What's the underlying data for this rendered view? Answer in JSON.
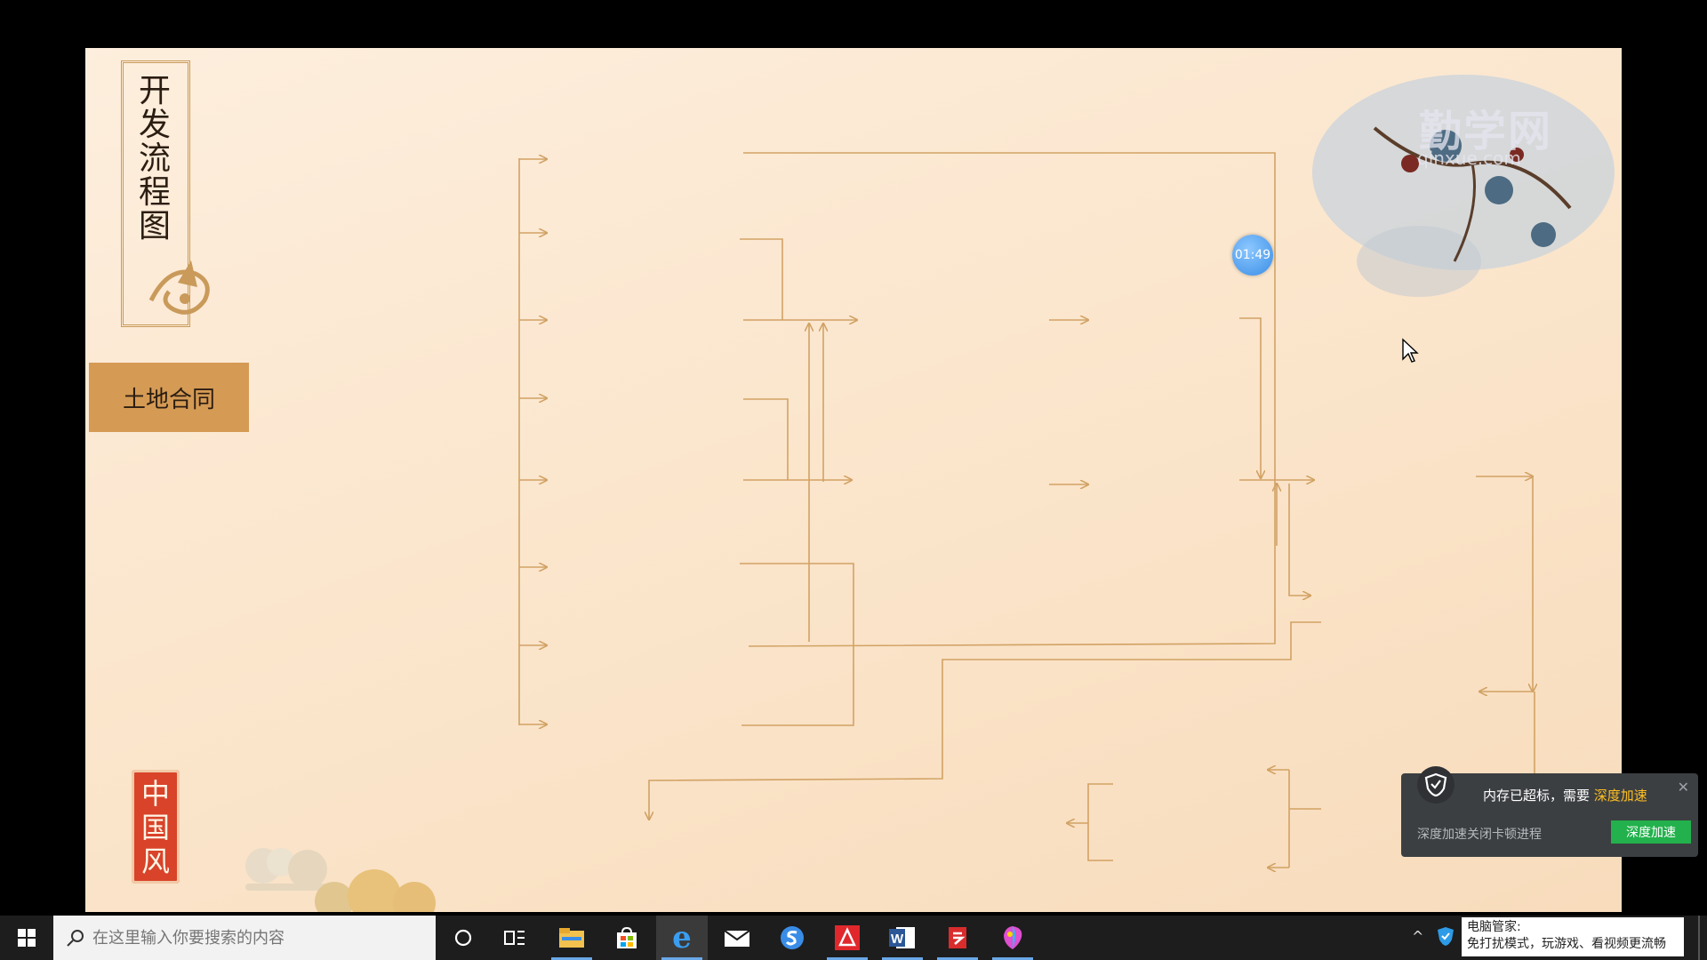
{
  "slide": {
    "title": "开发流程图",
    "badge": "土地合同",
    "stamp": "中国风",
    "watermark": "勤学网",
    "watermark_sub": "qinxue.com",
    "timer": "01:49"
  },
  "popup": {
    "message": "内存已超标，需要",
    "message_link": "深度加速",
    "subtext": "深度加速关闭卡顿进程",
    "button": "深度加速",
    "close": "✕"
  },
  "taskbar": {
    "search_placeholder": "在这里输入你要搜索的内容",
    "apps": [
      "cortana-icon",
      "task-view-icon",
      "file-explorer-icon",
      "store-icon",
      "edge-icon",
      "mail-icon",
      "sogou-icon",
      "acrobat-icon",
      "word-icon",
      "wps-icon",
      "paint-icon"
    ],
    "notice_title": "电脑管家:",
    "notice_text": "免打扰模式，玩游戏、看视频更流畅"
  },
  "colors": {
    "line": "#d1a264",
    "badge": "#d59a54",
    "stamp": "#d8432a",
    "popup_button": "#22b14c",
    "popup_link": "#ffc021"
  }
}
